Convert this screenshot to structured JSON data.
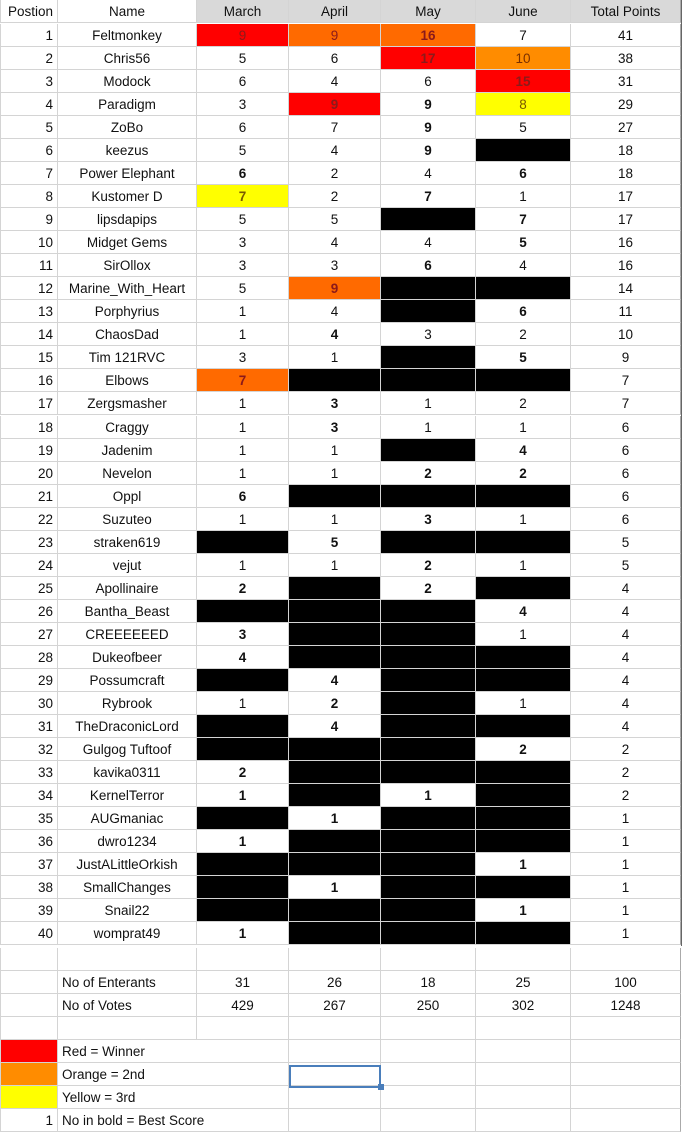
{
  "headers": [
    "Postion",
    "Name",
    "March",
    "April",
    "May",
    "June",
    "Total Points"
  ],
  "rows": [
    {
      "pos": "1",
      "name": "Feltmonkey",
      "m": [
        {
          "v": "9",
          "s": "red"
        },
        {
          "v": "9",
          "s": "org"
        },
        {
          "v": "16",
          "s": "org",
          "b": true
        },
        {
          "v": "7"
        }
      ],
      "total": "41"
    },
    {
      "pos": "2",
      "name": "Chris56",
      "m": [
        {
          "v": "5"
        },
        {
          "v": "6"
        },
        {
          "v": "17",
          "s": "red",
          "b": true
        },
        {
          "v": "10",
          "s": "org2"
        }
      ],
      "total": "38"
    },
    {
      "pos": "3",
      "name": "Modock",
      "m": [
        {
          "v": "6"
        },
        {
          "v": "4"
        },
        {
          "v": "6"
        },
        {
          "v": "15",
          "s": "red",
          "b": true
        }
      ],
      "total": "31"
    },
    {
      "pos": "4",
      "name": "Paradigm",
      "m": [
        {
          "v": "3"
        },
        {
          "v": "9",
          "s": "red",
          "b": true
        },
        {
          "v": "9",
          "b": true
        },
        {
          "v": "8",
          "s": "yel"
        }
      ],
      "total": "29"
    },
    {
      "pos": "5",
      "name": "ZoBo",
      "m": [
        {
          "v": "6"
        },
        {
          "v": "7"
        },
        {
          "v": "9",
          "b": true
        },
        {
          "v": "5"
        }
      ],
      "total": "27"
    },
    {
      "pos": "6",
      "name": "keezus",
      "m": [
        {
          "v": "5"
        },
        {
          "v": "4"
        },
        {
          "v": "9",
          "b": true
        },
        {
          "v": "",
          "s": "blk"
        }
      ],
      "total": "18"
    },
    {
      "pos": "7",
      "name": "Power Elephant",
      "m": [
        {
          "v": "6",
          "b": true
        },
        {
          "v": "2"
        },
        {
          "v": "4"
        },
        {
          "v": "6",
          "b": true
        }
      ],
      "total": "18"
    },
    {
      "pos": "8",
      "name": "Kustomer D",
      "m": [
        {
          "v": "7",
          "s": "yel",
          "b": true
        },
        {
          "v": "2"
        },
        {
          "v": "7",
          "b": true
        },
        {
          "v": "1"
        }
      ],
      "total": "17"
    },
    {
      "pos": "9",
      "name": "lipsdapips",
      "m": [
        {
          "v": "5"
        },
        {
          "v": "5"
        },
        {
          "v": "",
          "s": "blk"
        },
        {
          "v": "7",
          "b": true
        }
      ],
      "total": "17"
    },
    {
      "pos": "10",
      "name": "Midget Gems",
      "m": [
        {
          "v": "3"
        },
        {
          "v": "4"
        },
        {
          "v": "4"
        },
        {
          "v": "5",
          "b": true
        }
      ],
      "total": "16"
    },
    {
      "pos": "11",
      "name": "SirOllox",
      "m": [
        {
          "v": "3"
        },
        {
          "v": "3"
        },
        {
          "v": "6",
          "b": true
        },
        {
          "v": "4"
        }
      ],
      "total": "16"
    },
    {
      "pos": "12",
      "name": "Marine_With_Heart",
      "m": [
        {
          "v": "5"
        },
        {
          "v": "9",
          "s": "org",
          "b": true
        },
        {
          "v": "",
          "s": "blk"
        },
        {
          "v": "",
          "s": "blk"
        }
      ],
      "total": "14"
    },
    {
      "pos": "13",
      "name": "Porphyrius",
      "m": [
        {
          "v": "1"
        },
        {
          "v": "4"
        },
        {
          "v": "",
          "s": "blk"
        },
        {
          "v": "6",
          "b": true
        }
      ],
      "total": "11"
    },
    {
      "pos": "14",
      "name": "ChaosDad",
      "m": [
        {
          "v": "1"
        },
        {
          "v": "4",
          "b": true
        },
        {
          "v": "3"
        },
        {
          "v": "2"
        }
      ],
      "total": "10"
    },
    {
      "pos": "15",
      "name": "Tim 121RVC",
      "m": [
        {
          "v": "3"
        },
        {
          "v": "1"
        },
        {
          "v": "",
          "s": "blk"
        },
        {
          "v": "5",
          "b": true
        }
      ],
      "total": "9"
    },
    {
      "pos": "16",
      "name": "Elbows",
      "m": [
        {
          "v": "7",
          "s": "org",
          "b": true
        },
        {
          "v": "",
          "s": "blk"
        },
        {
          "v": "",
          "s": "blk"
        },
        {
          "v": "",
          "s": "blk"
        }
      ],
      "total": "7"
    },
    {
      "pos": "17",
      "name": "Zergsmasher",
      "m": [
        {
          "v": "1"
        },
        {
          "v": "3",
          "b": true
        },
        {
          "v": "1"
        },
        {
          "v": "2"
        }
      ],
      "total": "7"
    },
    {
      "pos": "18",
      "name": "Craggy",
      "m": [
        {
          "v": "1"
        },
        {
          "v": "3",
          "b": true
        },
        {
          "v": "1"
        },
        {
          "v": "1"
        }
      ],
      "total": "6"
    },
    {
      "pos": "19",
      "name": "Jadenim",
      "m": [
        {
          "v": "1"
        },
        {
          "v": "1"
        },
        {
          "v": "",
          "s": "blk"
        },
        {
          "v": "4",
          "b": true
        }
      ],
      "total": "6"
    },
    {
      "pos": "20",
      "name": "Nevelon",
      "m": [
        {
          "v": "1"
        },
        {
          "v": "1"
        },
        {
          "v": "2",
          "b": true
        },
        {
          "v": "2",
          "b": true
        }
      ],
      "total": "6"
    },
    {
      "pos": "21",
      "name": "Oppl",
      "m": [
        {
          "v": "6",
          "b": true
        },
        {
          "v": "",
          "s": "blk"
        },
        {
          "v": "",
          "s": "blk"
        },
        {
          "v": "",
          "s": "blk"
        }
      ],
      "total": "6"
    },
    {
      "pos": "22",
      "name": "Suzuteo",
      "m": [
        {
          "v": "1"
        },
        {
          "v": "1"
        },
        {
          "v": "3",
          "b": true
        },
        {
          "v": "1"
        }
      ],
      "total": "6"
    },
    {
      "pos": "23",
      "name": "straken619",
      "m": [
        {
          "v": "",
          "s": "blk"
        },
        {
          "v": "5",
          "b": true
        },
        {
          "v": "",
          "s": "blk"
        },
        {
          "v": "",
          "s": "blk"
        }
      ],
      "total": "5"
    },
    {
      "pos": "24",
      "name": "vejut",
      "m": [
        {
          "v": "1"
        },
        {
          "v": "1"
        },
        {
          "v": "2",
          "b": true
        },
        {
          "v": "1"
        }
      ],
      "total": "5"
    },
    {
      "pos": "25",
      "name": "Apollinaire",
      "m": [
        {
          "v": "2",
          "b": true
        },
        {
          "v": "",
          "s": "blk"
        },
        {
          "v": "2",
          "b": true
        },
        {
          "v": "",
          "s": "blk"
        }
      ],
      "total": "4"
    },
    {
      "pos": "26",
      "name": "Bantha_Beast",
      "m": [
        {
          "v": "",
          "s": "blk"
        },
        {
          "v": "",
          "s": "blk"
        },
        {
          "v": "",
          "s": "blk"
        },
        {
          "v": "4",
          "b": true
        }
      ],
      "total": "4"
    },
    {
      "pos": "27",
      "name": "CREEEEEED",
      "m": [
        {
          "v": "3",
          "b": true
        },
        {
          "v": "",
          "s": "blk"
        },
        {
          "v": "",
          "s": "blk"
        },
        {
          "v": "1"
        }
      ],
      "total": "4"
    },
    {
      "pos": "28",
      "name": "Dukeofbeer",
      "m": [
        {
          "v": "4",
          "b": true
        },
        {
          "v": "",
          "s": "blk"
        },
        {
          "v": "",
          "s": "blk"
        },
        {
          "v": "",
          "s": "blk"
        }
      ],
      "total": "4"
    },
    {
      "pos": "29",
      "name": "Possumcraft",
      "m": [
        {
          "v": "",
          "s": "blk"
        },
        {
          "v": "4",
          "b": true
        },
        {
          "v": "",
          "s": "blk"
        },
        {
          "v": "",
          "s": "blk"
        }
      ],
      "total": "4"
    },
    {
      "pos": "30",
      "name": "Rybrook",
      "m": [
        {
          "v": "1"
        },
        {
          "v": "2",
          "b": true
        },
        {
          "v": "",
          "s": "blk"
        },
        {
          "v": "1"
        }
      ],
      "total": "4"
    },
    {
      "pos": "31",
      "name": "TheDraconicLord",
      "m": [
        {
          "v": "",
          "s": "blk"
        },
        {
          "v": "4",
          "b": true
        },
        {
          "v": "",
          "s": "blk"
        },
        {
          "v": "",
          "s": "blk"
        }
      ],
      "total": "4"
    },
    {
      "pos": "32",
      "name": "Gulgog Tuftoof",
      "m": [
        {
          "v": "",
          "s": "blk"
        },
        {
          "v": "",
          "s": "blk"
        },
        {
          "v": "",
          "s": "blk"
        },
        {
          "v": "2",
          "b": true
        }
      ],
      "total": "2"
    },
    {
      "pos": "33",
      "name": "kavika0311",
      "m": [
        {
          "v": "2",
          "b": true
        },
        {
          "v": "",
          "s": "blk"
        },
        {
          "v": "",
          "s": "blk"
        },
        {
          "v": "",
          "s": "blk"
        }
      ],
      "total": "2"
    },
    {
      "pos": "34",
      "name": "KernelTerror",
      "m": [
        {
          "v": "1",
          "b": true
        },
        {
          "v": "",
          "s": "blk"
        },
        {
          "v": "1",
          "b": true
        },
        {
          "v": "",
          "s": "blk"
        }
      ],
      "total": "2"
    },
    {
      "pos": "35",
      "name": "AUGmaniac",
      "m": [
        {
          "v": "",
          "s": "blk"
        },
        {
          "v": "1",
          "b": true
        },
        {
          "v": "",
          "s": "blk"
        },
        {
          "v": "",
          "s": "blk"
        }
      ],
      "total": "1"
    },
    {
      "pos": "36",
      "name": "dwro1234",
      "m": [
        {
          "v": "1",
          "b": true
        },
        {
          "v": "",
          "s": "blk"
        },
        {
          "v": "",
          "s": "blk"
        },
        {
          "v": "",
          "s": "blk"
        }
      ],
      "total": "1"
    },
    {
      "pos": "37",
      "name": "JustALittleOrkish",
      "m": [
        {
          "v": "",
          "s": "blk"
        },
        {
          "v": "",
          "s": "blk"
        },
        {
          "v": "",
          "s": "blk"
        },
        {
          "v": "1",
          "b": true
        }
      ],
      "total": "1"
    },
    {
      "pos": "38",
      "name": "SmallChanges",
      "m": [
        {
          "v": "",
          "s": "blk"
        },
        {
          "v": "1",
          "b": true
        },
        {
          "v": "",
          "s": "blk"
        },
        {
          "v": "",
          "s": "blk"
        }
      ],
      "total": "1"
    },
    {
      "pos": "39",
      "name": "Snail22",
      "m": [
        {
          "v": "",
          "s": "blk"
        },
        {
          "v": "",
          "s": "blk"
        },
        {
          "v": "",
          "s": "blk"
        },
        {
          "v": "1",
          "b": true
        }
      ],
      "total": "1"
    },
    {
      "pos": "40",
      "name": "womprat49",
      "m": [
        {
          "v": "1",
          "b": true
        },
        {
          "v": "",
          "s": "blk"
        },
        {
          "v": "",
          "s": "blk"
        },
        {
          "v": "",
          "s": "blk"
        }
      ],
      "total": "1"
    }
  ],
  "summary": [
    {
      "label": "No of Enterants",
      "values": [
        "31",
        "26",
        "18",
        "25"
      ],
      "total": "100"
    },
    {
      "label": "No of Votes",
      "values": [
        "429",
        "267",
        "250",
        "302"
      ],
      "total": "1248"
    }
  ],
  "legend": [
    {
      "color": "#ff0000",
      "label": "Red = Winner"
    },
    {
      "color": "#ff8c00",
      "label": "Orange =  2nd"
    },
    {
      "color": "#ffff00",
      "label": "Yellow = 3rd"
    },
    {
      "prefix": "1",
      "label": "No in bold = Best Score"
    }
  ]
}
